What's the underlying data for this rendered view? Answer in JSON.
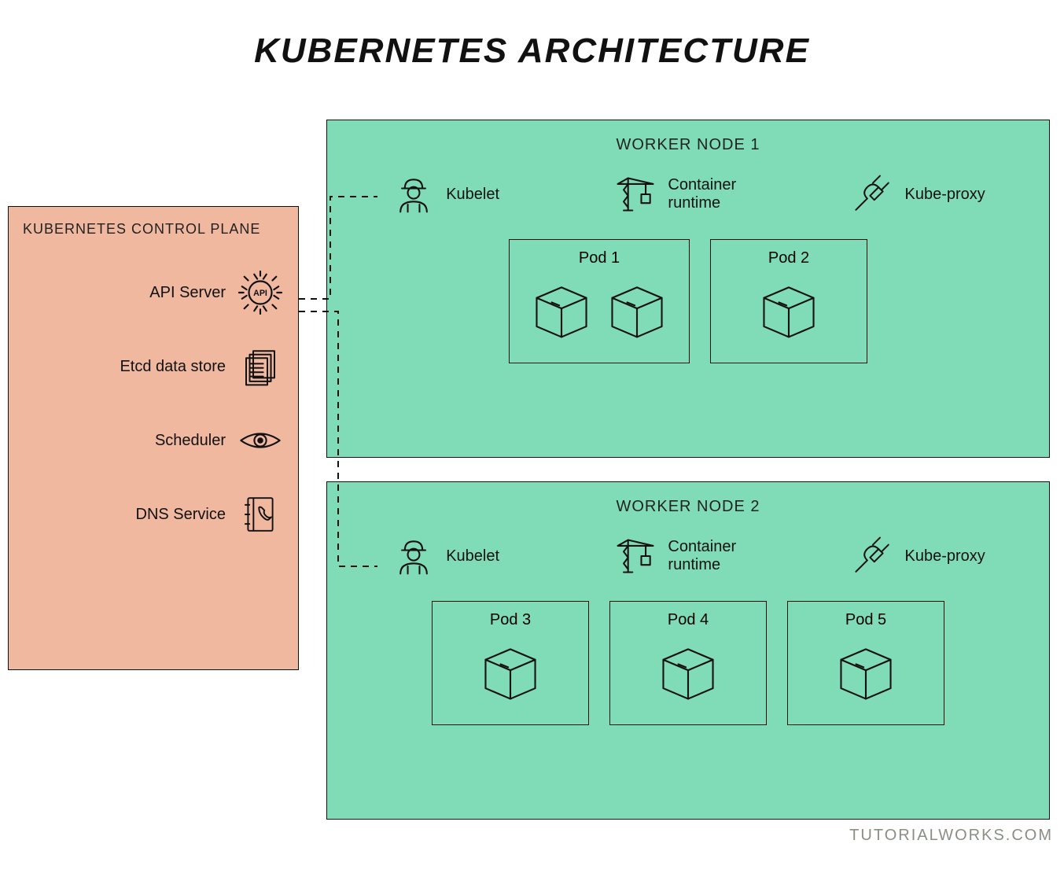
{
  "title": "KUBERNETES ARCHITECTURE",
  "credit": "TUTORIALWORKS.COM",
  "control_plane": {
    "title": "KUBERNETES CONTROL PLANE",
    "items": [
      {
        "label": "API Server",
        "icon": "api-gear-icon",
        "inner": "API"
      },
      {
        "label": "Etcd data store",
        "icon": "document-stack-icon"
      },
      {
        "label": "Scheduler",
        "icon": "eye-icon"
      },
      {
        "label": "DNS Service",
        "icon": "phonebook-icon"
      }
    ]
  },
  "workers": [
    {
      "title": "WORKER NODE 1",
      "agents": [
        {
          "label": "Kubelet",
          "icon": "worker-person-icon"
        },
        {
          "label": "Container\nruntime",
          "icon": "crane-icon"
        },
        {
          "label": "Kube-proxy",
          "icon": "plug-icon"
        }
      ],
      "pods": [
        {
          "title": "Pod 1",
          "boxes": 2
        },
        {
          "title": "Pod 2",
          "boxes": 1
        }
      ]
    },
    {
      "title": "WORKER NODE 2",
      "agents": [
        {
          "label": "Kubelet",
          "icon": "worker-person-icon"
        },
        {
          "label": "Container\nruntime",
          "icon": "crane-icon"
        },
        {
          "label": "Kube-proxy",
          "icon": "plug-icon"
        }
      ],
      "pods": [
        {
          "title": "Pod 3",
          "boxes": 1
        },
        {
          "title": "Pod 4",
          "boxes": 1
        },
        {
          "title": "Pod 5",
          "boxes": 1
        }
      ]
    }
  ]
}
